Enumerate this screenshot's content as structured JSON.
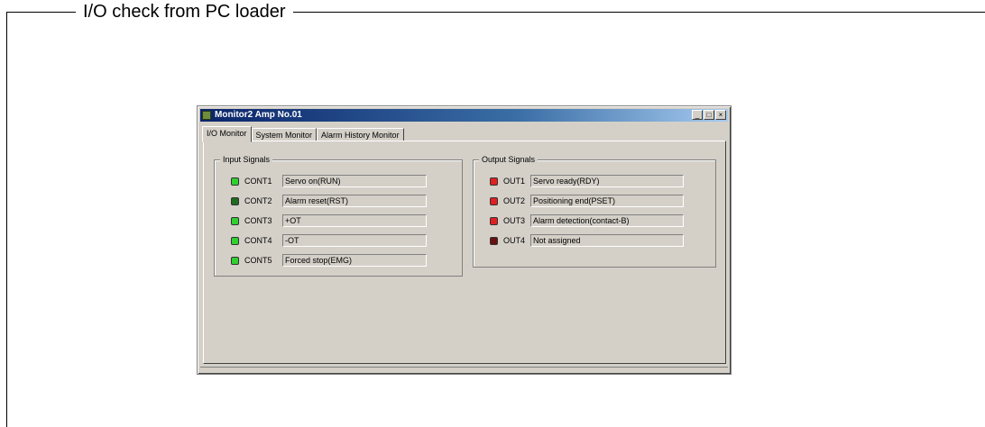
{
  "document": {
    "title": "I/O check from PC loader"
  },
  "window": {
    "title": "Monitor2 Amp No.01",
    "controls": {
      "minimize": "_",
      "maximize": "□",
      "close": "×"
    }
  },
  "tabs": [
    {
      "label": "I/O Monitor",
      "active": true
    },
    {
      "label": "System Monitor",
      "active": false
    },
    {
      "label": "Alarm History Monitor",
      "active": false
    }
  ],
  "input_signals": {
    "title": "Input Signals",
    "rows": [
      {
        "name": "CONT1",
        "value": "Servo on(RUN)",
        "led_color": "#2fd02f"
      },
      {
        "name": "CONT2",
        "value": "Alarm reset(RST)",
        "led_color": "#1f6b1f"
      },
      {
        "name": "CONT3",
        "value": "+OT",
        "led_color": "#2fd02f"
      },
      {
        "name": "CONT4",
        "value": "-OT",
        "led_color": "#2fd02f"
      },
      {
        "name": "CONT5",
        "value": "Forced stop(EMG)",
        "led_color": "#2fd02f"
      }
    ]
  },
  "output_signals": {
    "title": "Output Signals",
    "rows": [
      {
        "name": "OUT1",
        "value": "Servo ready(RDY)",
        "led_color": "#e02020"
      },
      {
        "name": "OUT2",
        "value": "Positioning end(PSET)",
        "led_color": "#e02020"
      },
      {
        "name": "OUT3",
        "value": "Alarm detection(contact-B)",
        "led_color": "#e02020"
      },
      {
        "name": "OUT4",
        "value": "Not assigned",
        "led_color": "#6a1010"
      }
    ]
  }
}
